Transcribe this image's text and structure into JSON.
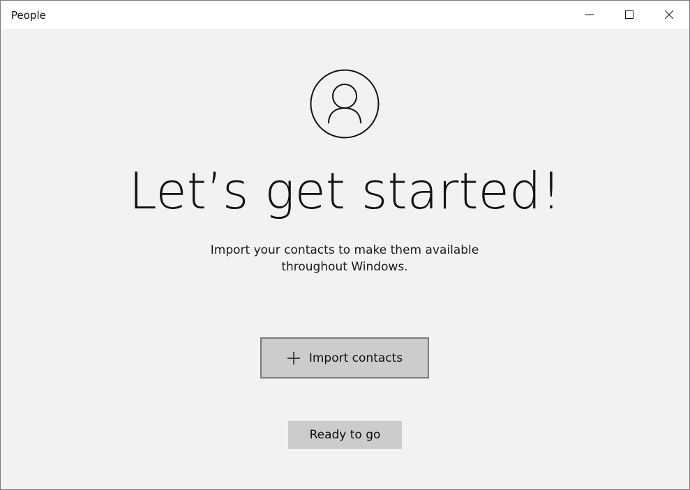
{
  "window": {
    "title": "People",
    "controls": {
      "minimize_icon": "minimize-icon",
      "maximize_icon": "maximize-icon",
      "close_icon": "close-icon"
    }
  },
  "main": {
    "avatar_icon": "person-icon",
    "headline": "Let’s get started!",
    "subtitle_line1": "Import your contacts to make them available",
    "subtitle_line2": "throughout Windows.",
    "import_button": {
      "icon": "plus-icon",
      "label": "Import contacts"
    },
    "ready_button": {
      "label": "Ready to go"
    }
  },
  "colors": {
    "background": "#f2f2f2",
    "titlebar": "#ffffff",
    "button_fill": "#cccccc",
    "button_border": "#7a7a7a",
    "text": "#111111"
  }
}
